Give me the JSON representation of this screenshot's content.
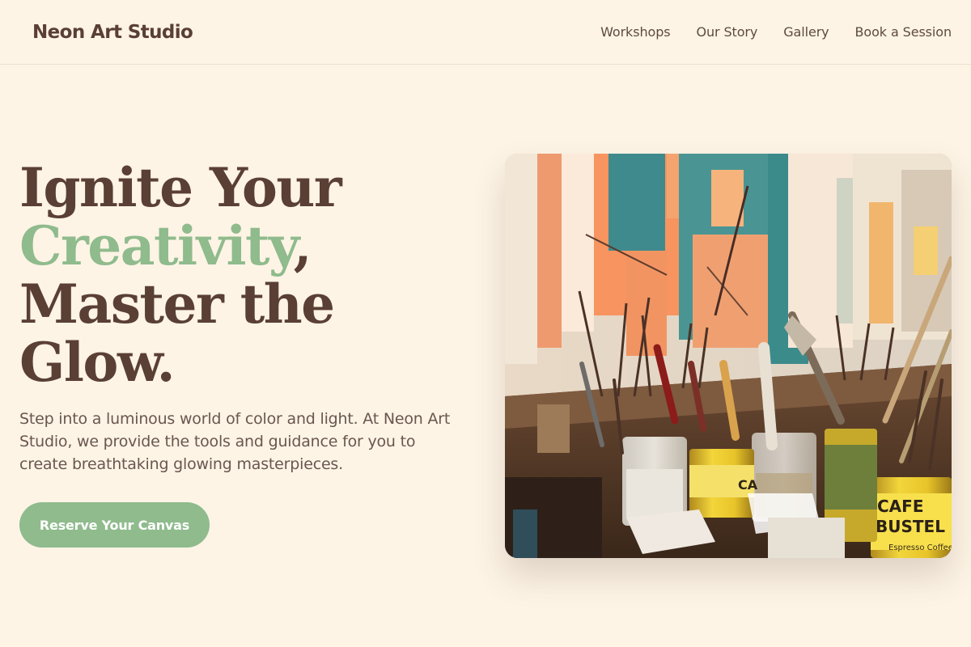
{
  "header": {
    "brand": "Neon Art Studio",
    "nav": [
      {
        "label": "Workshops"
      },
      {
        "label": "Our Story"
      },
      {
        "label": "Gallery"
      },
      {
        "label": "Book a Session"
      }
    ]
  },
  "hero": {
    "title_line1": "Ignite Your",
    "title_accent": "Creativity",
    "title_comma": ",",
    "title_line3": "Master the",
    "title_line4": "Glow.",
    "description": "Step into a luminous world of color and light. At Neon Art Studio, we provide the tools and guidance for you to create breathtaking glowing masterpieces.",
    "cta_label": "Reserve Your Canvas",
    "image": {
      "can_label_1": "CAFE",
      "can_label_2": "BUSTEL",
      "can_label_3": "Espresso Coffee",
      "can_label_left": "CA"
    }
  },
  "colors": {
    "background": "#fdf4e5",
    "text_brown": "#5a3f35",
    "accent_green": "#8fbb8d",
    "button_text": "#ffffff"
  }
}
